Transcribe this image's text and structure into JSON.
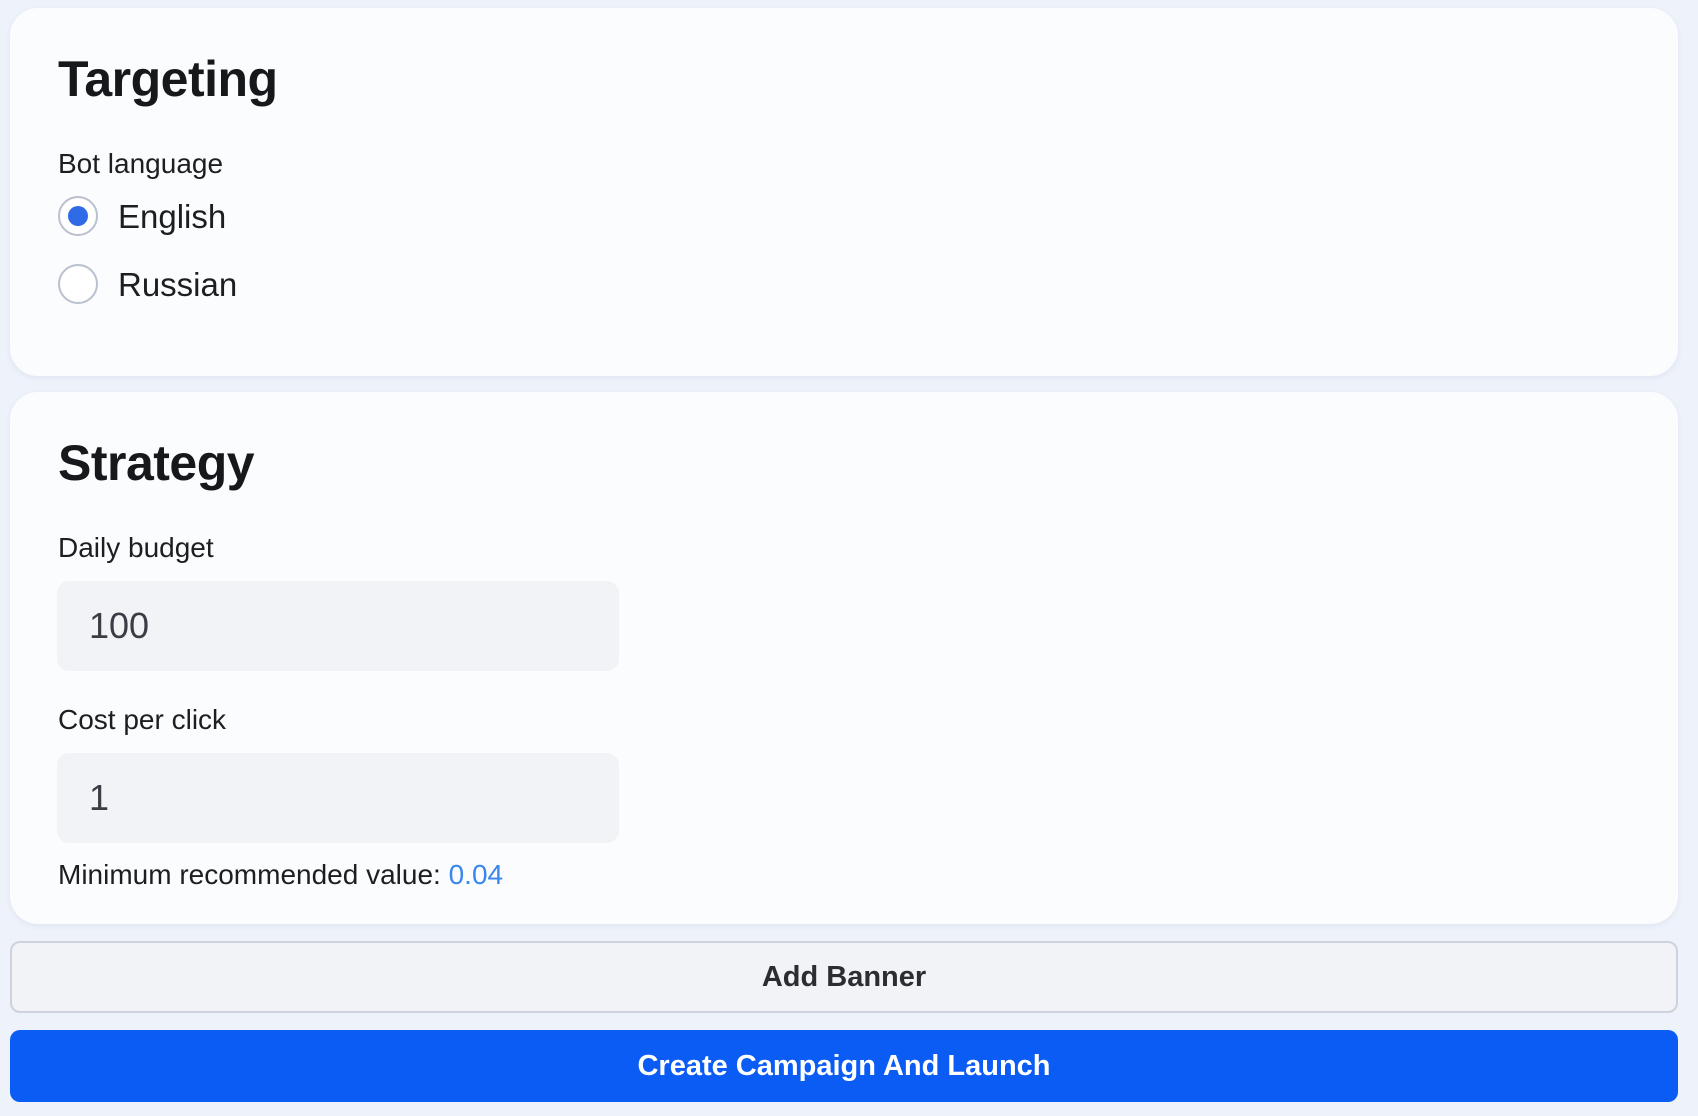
{
  "targeting": {
    "title": "Targeting",
    "bot_language_label": "Bot language",
    "options": [
      {
        "label": "English",
        "selected": true
      },
      {
        "label": "Russian",
        "selected": false
      }
    ]
  },
  "strategy": {
    "title": "Strategy",
    "daily_budget_label": "Daily budget",
    "daily_budget_value": "100",
    "cost_per_click_label": "Cost per click",
    "cost_per_click_value": "1",
    "min_hint_prefix": "Minimum recommended value: ",
    "min_hint_value": "0.04"
  },
  "actions": {
    "add_banner_label": "Add Banner",
    "create_label": "Create Campaign And Launch"
  },
  "colors": {
    "page_bg": "#eef2fa",
    "card_bg": "#fbfcfe",
    "accent": "#0b5cf5",
    "radio_selected": "#2f6be6",
    "hint_value": "#3a86ef"
  }
}
